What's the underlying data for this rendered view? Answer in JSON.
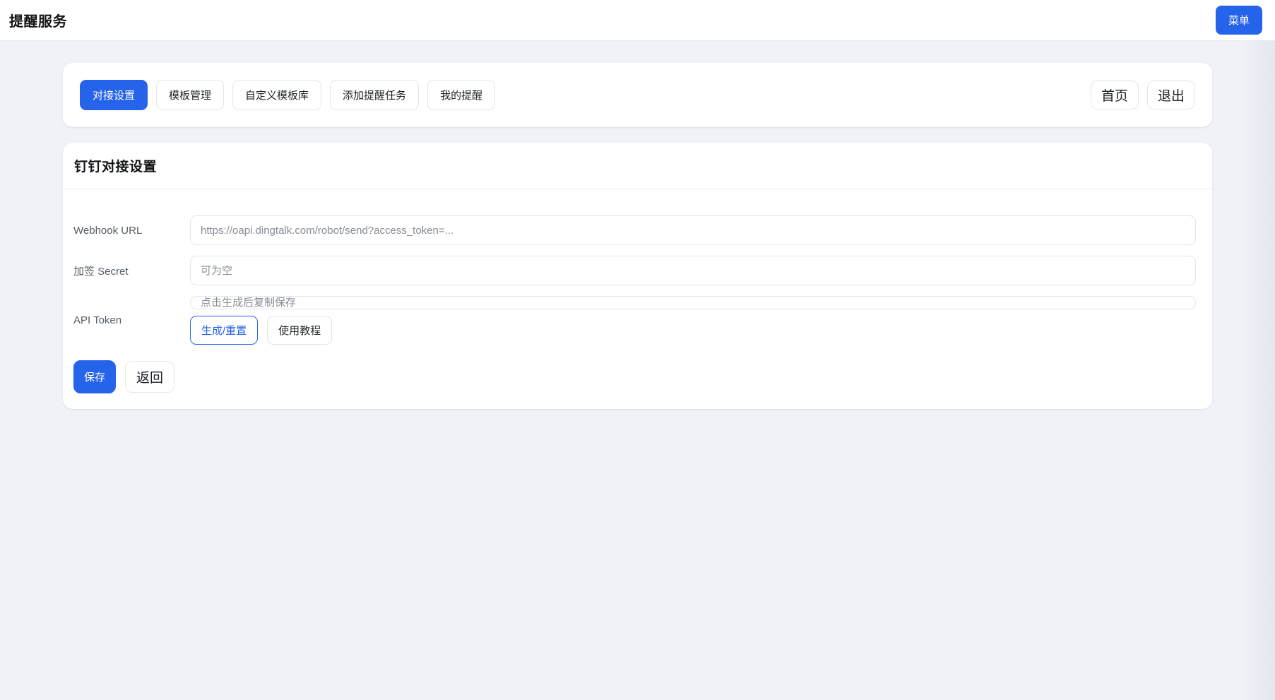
{
  "header": {
    "title": "提醒服务",
    "menu_button": "菜单"
  },
  "nav": {
    "tabs": [
      {
        "label": "对接设置",
        "active": true
      },
      {
        "label": "模板管理",
        "active": false
      },
      {
        "label": "自定义模板库",
        "active": false
      },
      {
        "label": "添加提醒任务",
        "active": false
      },
      {
        "label": "我的提醒",
        "active": false
      }
    ],
    "home_button": "首页",
    "exit_button": "退出"
  },
  "settings": {
    "title": "钉钉对接设置",
    "fields": {
      "webhook": {
        "label": "Webhook URL",
        "value": "",
        "placeholder": "https://oapi.dingtalk.com/robot/send?access_token=..."
      },
      "secret": {
        "label": "加签 Secret",
        "value": "",
        "placeholder": "可为空"
      },
      "token": {
        "label": "API Token",
        "value": "",
        "placeholder": "点击生成后复制保存",
        "generate_button": "生成/重置",
        "tutorial_button": "使用教程"
      }
    },
    "save_button": "保存",
    "back_button": "返回"
  },
  "colors": {
    "accent": "#2563eb",
    "background": "#f0f2f7"
  }
}
